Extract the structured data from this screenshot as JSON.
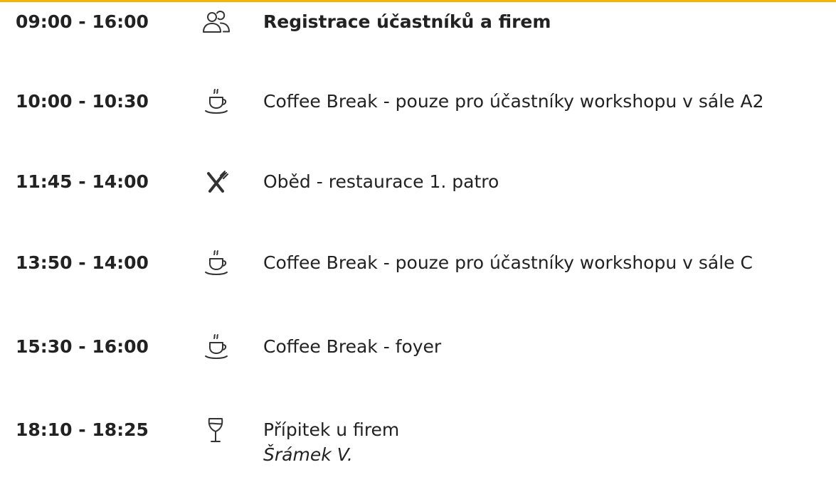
{
  "accent_color": "#f2b600",
  "agenda": {
    "items": [
      {
        "time": "09:00 - 16:00",
        "icon": "people-icon",
        "title": "Registrace účastníků a firem",
        "emphasis": "bold"
      },
      {
        "time": "10:00 - 10:30",
        "icon": "coffee-cup-icon",
        "title": "Coffee Break - pouze pro účastníky workshopu v sále A2"
      },
      {
        "time": "11:45 - 14:00",
        "icon": "fork-knife-icon",
        "title": "Oběd - restaurace 1. patro"
      },
      {
        "time": "13:50 - 14:00",
        "icon": "coffee-cup-icon",
        "title": "Coffee Break - pouze pro účastníky workshopu v sále C"
      },
      {
        "time": "15:30 - 16:00",
        "icon": "coffee-cup-icon",
        "title": "Coffee Break - foyer"
      },
      {
        "time": "18:10 - 18:25",
        "icon": "wine-glass-icon",
        "title": "Přípitek u firem",
        "speaker": "Šrámek V."
      }
    ]
  }
}
